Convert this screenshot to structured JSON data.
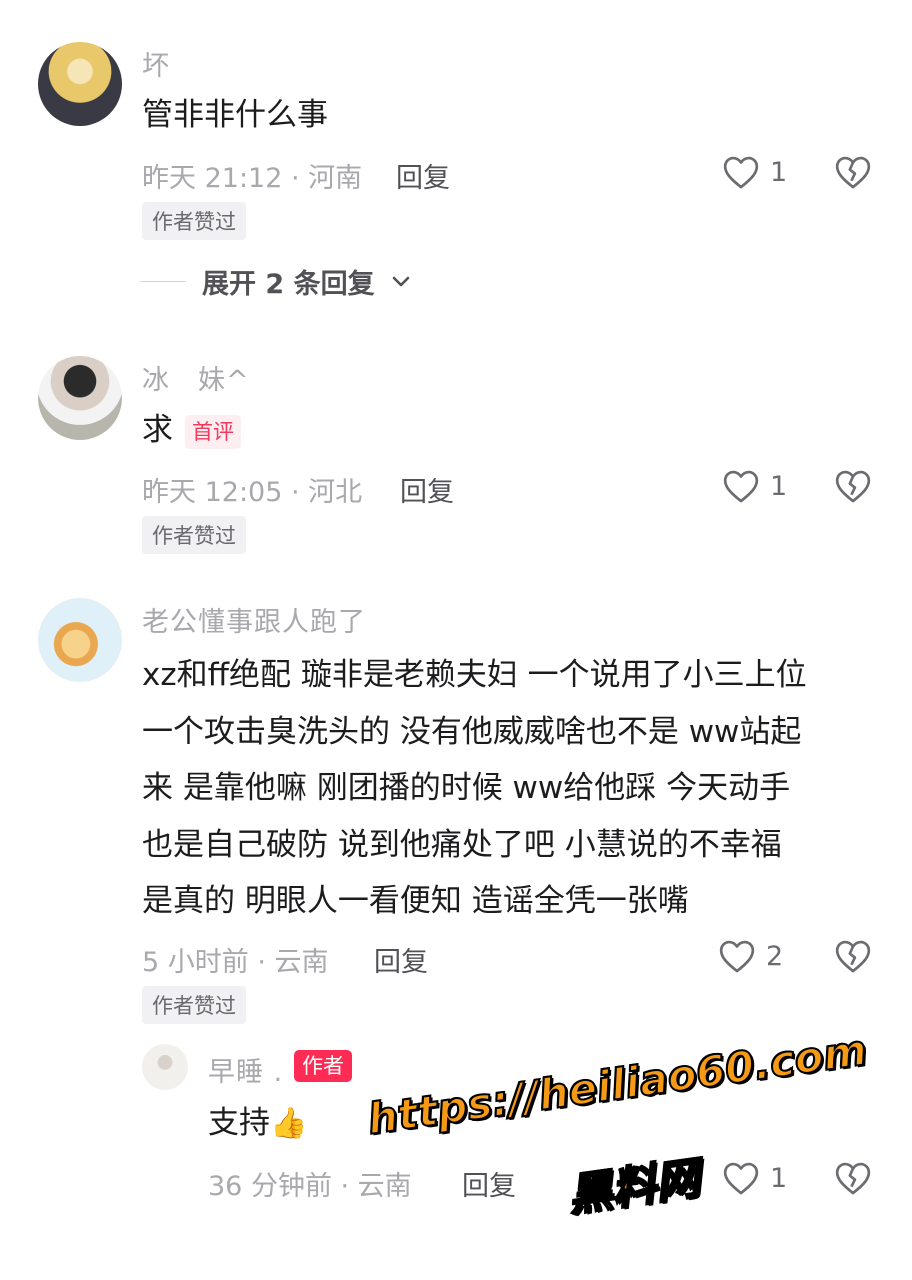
{
  "comments": [
    {
      "username": "坏",
      "text": "管非非什么事",
      "meta": "昨天 21:12 · 河南",
      "reply": "回复",
      "likes": "1",
      "badge": "作者赞过",
      "expand": "展开 2 条回复"
    },
    {
      "username": "冰　妹^",
      "text": "求",
      "tag": "首评",
      "meta": "昨天 12:05 · 河北",
      "reply": "回复",
      "likes": "1",
      "badge": "作者赞过"
    },
    {
      "username": "老公懂事跟人跑了",
      "lines": [
        "xz和ff绝配 璇非是老赖夫妇 一个说用了小三上位",
        "一个攻击臭洗头的 没有他威威啥也不是 ww站起",
        "来 是靠他嘛 刚团播的时候 ww给他踩 今天动手",
        "也是自己破防 说到他痛处了吧 小慧说的不幸福",
        "是真的 明眼人一看便知 造谣全凭一张嘴"
      ],
      "meta": "5 小时前 · 云南",
      "reply": "回复",
      "likes": "2",
      "badge": "作者赞过"
    }
  ],
  "reply_comment": {
    "username": "早睡 .",
    "author_tag": "作者",
    "text": "支持",
    "emoji": "👍",
    "meta": "36 分钟前 · 云南",
    "reply": "回复",
    "likes": "1"
  },
  "watermark": {
    "url": "https://heiliao60.com",
    "name": "黑料网"
  },
  "icons": {
    "like": "heart-outline-icon",
    "dislike": "broken-heart-icon",
    "expand": "chevron-down-icon"
  },
  "colors": {
    "author_tag": "#fe2c55",
    "watermark": "#f59a16"
  }
}
